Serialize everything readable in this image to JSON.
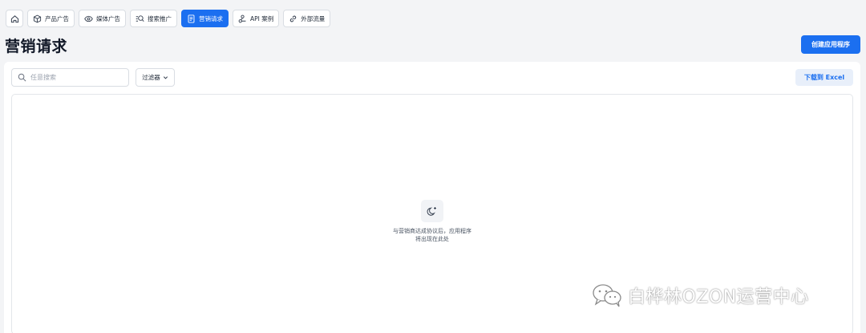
{
  "tabs": [
    {
      "label": "",
      "icon": "home-icon"
    },
    {
      "label": "产品广告",
      "icon": "box-icon"
    },
    {
      "label": "媒体广告",
      "icon": "eye-icon"
    },
    {
      "label": "搜索推广",
      "icon": "search-list-icon"
    },
    {
      "label": "营销请求",
      "icon": "document-icon",
      "active": true
    },
    {
      "label": "API 案例",
      "icon": "api-icon"
    },
    {
      "label": "外部流量",
      "icon": "link-icon"
    }
  ],
  "header": {
    "title": "营销请求",
    "create_button": "创建应用程序"
  },
  "toolbar": {
    "search_placeholder": "任意搜索",
    "search_value": "",
    "filter_label": "过滤器",
    "excel_button": "下载到 Excel"
  },
  "empty_state": {
    "icon": "sparkle-moon-icon",
    "line1": "与营销商达成协议后，应用程序",
    "line2": "将出现在此处"
  },
  "watermark": {
    "text": "白桦林OZON运营中心",
    "icon": "wechat-icon"
  },
  "colors": {
    "accent": "#1b6ff0",
    "background": "#f3f4f6",
    "panel": "#ffffff"
  }
}
